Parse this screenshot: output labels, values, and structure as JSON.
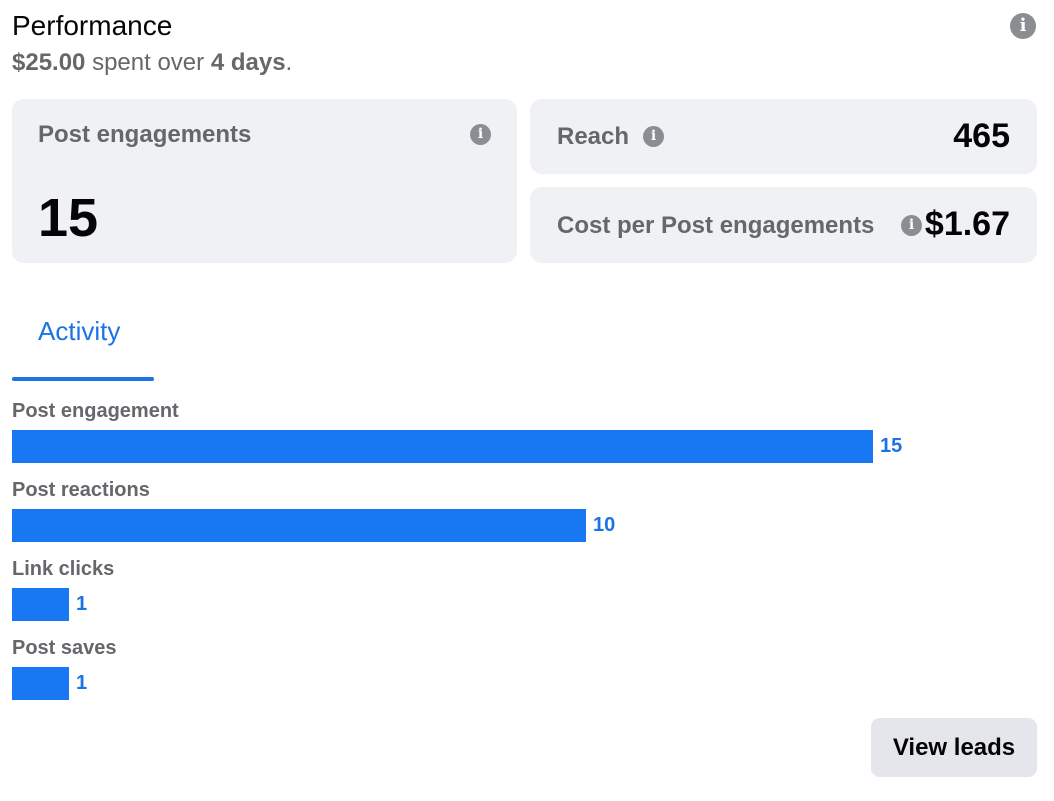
{
  "header": {
    "title": "Performance",
    "spent_amount": "$25.00",
    "spent_text": "spent over",
    "days": "4 days",
    "period": ".",
    "info_icon": "info-icon"
  },
  "metrics": {
    "post_engagements": {
      "label": "Post engagements",
      "value": "15",
      "icon": "info-icon"
    },
    "reach": {
      "label": "Reach",
      "value": "465",
      "icon": "info-icon"
    },
    "cost_per": {
      "label": "Cost per Post engagements",
      "value": "$1.67",
      "icon": "info-icon"
    }
  },
  "tabs": [
    {
      "label": "Activity",
      "active": true
    }
  ],
  "chart_data": {
    "type": "bar",
    "orientation": "horizontal",
    "categories": [
      "Post engagement",
      "Post reactions",
      "Link clicks",
      "Post saves"
    ],
    "values": [
      15,
      10,
      1,
      1
    ],
    "data_labels": [
      "15",
      "10",
      "1",
      "1"
    ],
    "xlim": [
      0,
      15
    ],
    "grid": false,
    "bar_color": "#1877f2"
  },
  "actions": {
    "view_leads": "View leads"
  },
  "colors": {
    "accent": "#1b74e4",
    "bar": "#1877f2",
    "card_bg": "#eff1f4",
    "secondary_text": "#65676b"
  }
}
